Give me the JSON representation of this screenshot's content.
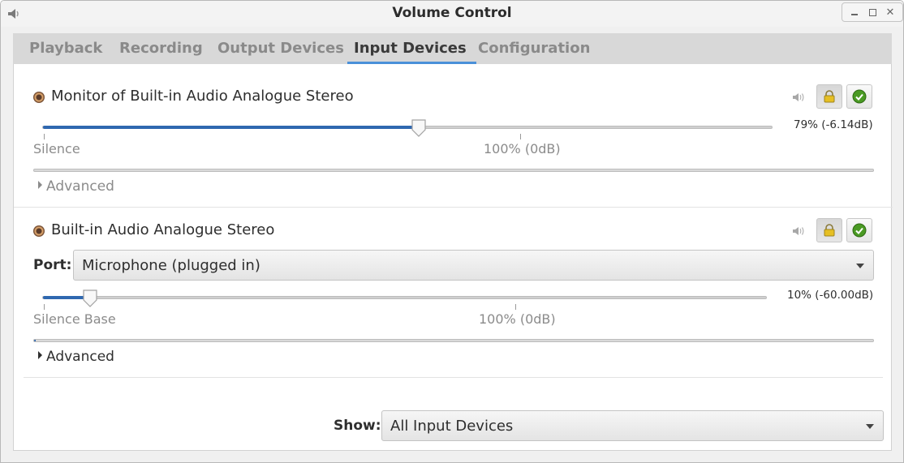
{
  "window": {
    "title": "Volume Control"
  },
  "tabs": [
    {
      "label": "Playback",
      "active": false
    },
    {
      "label": "Recording",
      "active": false
    },
    {
      "label": "Output Devices",
      "active": false
    },
    {
      "label": "Input Devices",
      "active": true
    },
    {
      "label": "Configuration",
      "active": false
    }
  ],
  "devices": [
    {
      "name": "Monitor of Built-in Audio Analogue Stereo",
      "volume_text": "79% (-6.14dB)",
      "volume_fraction": 0.515,
      "left_mark": "Silence",
      "center_mark": "100% (0dB)",
      "level_fraction": 0.0,
      "advanced_label": "Advanced"
    },
    {
      "name": "Built-in Audio Analogue Stereo",
      "port_label": "Port:",
      "port_value": "Microphone (plugged in)",
      "volume_text": "10% (-60.00dB)",
      "volume_fraction": 0.066,
      "left_mark": "Silence Base",
      "center_mark": "100% (0dB)",
      "level_fraction": 0.002,
      "advanced_label": "Advanced"
    }
  ],
  "footer": {
    "show_label": "Show:",
    "show_value": "All Input Devices"
  },
  "colors": {
    "accent": "#4a90d9",
    "slider_fill": "#2f68b0",
    "lock": "#e0b400",
    "check": "#3f8a1f"
  },
  "icons": {
    "app": "speaker-icon",
    "mute": "speaker-muted-icon",
    "lock": "lock-icon",
    "default": "checkmark-icon"
  }
}
